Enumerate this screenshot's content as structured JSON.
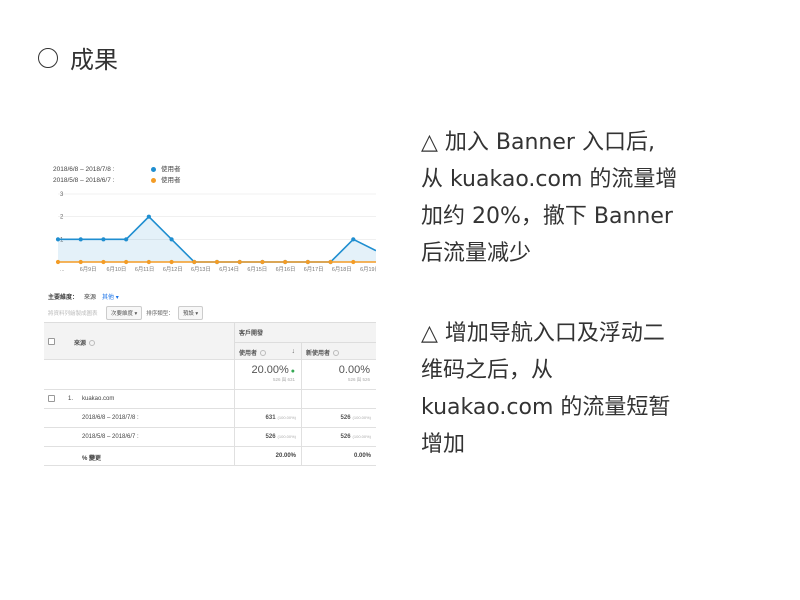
{
  "slide": {
    "title": "成果"
  },
  "notes": [
    {
      "lines": [
        "△ 加入 Banner 入口后,",
        "从 kuakao.com 的流量增",
        "加约 20%，撤下 Banner",
        "后流量减少"
      ]
    },
    {
      "lines": [
        "△ 增加导航入口及浮动二",
        "维码之后，从",
        "kuakao.com 的流量短暂",
        "增加"
      ]
    }
  ],
  "legend": [
    {
      "range": "2018/6/8 – 2018/7/8 :",
      "name": "使用者",
      "color": "#1f8ed0"
    },
    {
      "range": "2018/5/8 – 2018/6/7 :",
      "name": "使用者",
      "color": "#f39c26"
    }
  ],
  "chart_data": {
    "type": "line",
    "categories": [
      "...",
      "6月9日",
      "6月10日",
      "6月11日",
      "6月12日",
      "6月13日",
      "6月14日",
      "6月15日",
      "6月16日",
      "6月17日",
      "6月18日",
      "6月19日"
    ],
    "y_ticks": [
      "3",
      "2",
      "1"
    ],
    "ylim": [
      0,
      3
    ],
    "grid": true,
    "series": [
      {
        "name": "使用者",
        "color": "#1f8ed0",
        "values": [
          1,
          1,
          1,
          1,
          2,
          1,
          0,
          0,
          0,
          0,
          0,
          0,
          0,
          1,
          0.5
        ]
      },
      {
        "name": "使用者",
        "color": "#f39c26",
        "values": [
          0,
          0,
          0,
          0,
          0,
          0,
          0,
          0,
          0,
          0,
          0,
          0,
          0,
          0,
          0
        ]
      }
    ]
  },
  "dimensions": {
    "label": "主要維度：",
    "primary": "來源",
    "other": "其他 ▾"
  },
  "toolbar": {
    "placeholder": "將資料列繪製成圖表",
    "secondary": "次要維度 ▾",
    "sort_label": "排序類型：",
    "sort_value": "預設 ▾"
  },
  "table": {
    "source_header": "來源",
    "group_header": "客戶開發",
    "metric1": "使用者",
    "metric2": "新使用者",
    "sort_icon": "↓",
    "summary": {
      "m1_value": "20.00%",
      "m1_sub": "526 與 631",
      "m2_value": "0.00%",
      "m2_sub": "526 與 526"
    },
    "row": {
      "index": "1.",
      "name": "kuakao.com"
    },
    "sub_rows": [
      {
        "date": "2018/6/8 – 2018/7/8 :",
        "m1": "631",
        "m1_pct": "(100.00%)",
        "m2": "526",
        "m2_pct": "(100.00%)"
      },
      {
        "date": "2018/5/8 – 2018/6/7 :",
        "m1": "526",
        "m1_pct": "(100.00%)",
        "m2": "526",
        "m2_pct": "(100.00%)"
      }
    ],
    "change_row": {
      "label": "% 變更",
      "m1": "20.00%",
      "m2": "0.00%"
    }
  }
}
